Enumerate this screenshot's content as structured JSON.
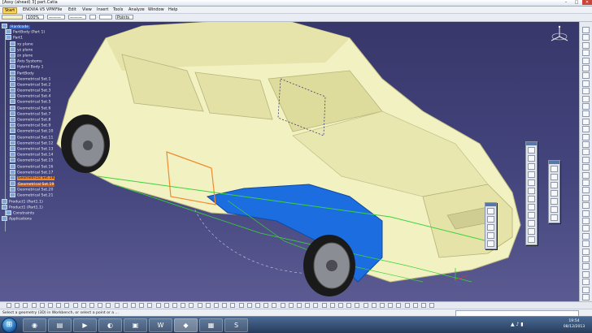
{
  "app": {
    "title": "[Assy (ahead) 3] part.Catia",
    "window_controls": [
      "–",
      "□",
      "✕"
    ]
  },
  "menubar": {
    "start_label": "Start",
    "items": [
      "ENOVIA V5 VPM",
      "File",
      "Edit",
      "View",
      "Insert",
      "Tools",
      "Analyze",
      "Window",
      "Help"
    ]
  },
  "propbar": {
    "color_value": "",
    "opacity_value": "100%",
    "line_type_value": "———",
    "line_weight_value": "———",
    "layer_value": "Points"
  },
  "tree": {
    "nodes": [
      {
        "label": "Hardcode",
        "level": 0,
        "style": "root"
      },
      {
        "label": "PartBody (Part 1)",
        "level": 1,
        "style": ""
      },
      {
        "label": "Part1",
        "level": 1,
        "style": ""
      },
      {
        "label": "xy plane",
        "level": 2,
        "style": ""
      },
      {
        "label": "yz plane",
        "level": 2,
        "style": ""
      },
      {
        "label": "zx plane",
        "level": 2,
        "style": ""
      },
      {
        "label": "Axis Systems",
        "level": 2,
        "style": ""
      },
      {
        "label": "Hybrid Body 1",
        "level": 2,
        "style": ""
      },
      {
        "label": "PartBody",
        "level": 2,
        "style": ""
      },
      {
        "label": "Geometrical Set.1",
        "level": 2,
        "style": ""
      },
      {
        "label": "Geometrical Set.2",
        "level": 2,
        "style": ""
      },
      {
        "label": "Geometrical Set.3",
        "level": 2,
        "style": ""
      },
      {
        "label": "Geometrical Set.4",
        "level": 2,
        "style": ""
      },
      {
        "label": "Geometrical Set.5",
        "level": 2,
        "style": ""
      },
      {
        "label": "Geometrical Set.6",
        "level": 2,
        "style": ""
      },
      {
        "label": "Geometrical Set.7",
        "level": 2,
        "style": ""
      },
      {
        "label": "Geometrical Set.8",
        "level": 2,
        "style": ""
      },
      {
        "label": "Geometrical Set.9",
        "level": 2,
        "style": ""
      },
      {
        "label": "Geometrical Set.10",
        "level": 2,
        "style": ""
      },
      {
        "label": "Geometrical Set.11",
        "level": 2,
        "style": ""
      },
      {
        "label": "Geometrical Set.12",
        "level": 2,
        "style": ""
      },
      {
        "label": "Geometrical Set.13",
        "level": 2,
        "style": ""
      },
      {
        "label": "Geometrical Set.14",
        "level": 2,
        "style": ""
      },
      {
        "label": "Geometrical Set.15",
        "level": 2,
        "style": ""
      },
      {
        "label": "Geometrical Set.16",
        "level": 2,
        "style": ""
      },
      {
        "label": "Geometrical Set.17",
        "level": 2,
        "style": ""
      },
      {
        "label": "Geometrical Set.18",
        "level": 2,
        "style": "hl"
      },
      {
        "label": "Geometrical Set.19",
        "level": 2,
        "style": "sel"
      },
      {
        "label": "Geometrical Set.20",
        "level": 2,
        "style": ""
      },
      {
        "label": "Geometrical Set.21",
        "level": 2,
        "style": ""
      },
      {
        "label": "Product1 (Part1.1)",
        "level": 0,
        "style": ""
      },
      {
        "label": "Product1 (Part1.1)",
        "level": 0,
        "style": ""
      },
      {
        "label": "Constraints",
        "level": 1,
        "style": ""
      },
      {
        "label": "Applications",
        "level": 0,
        "style": ""
      }
    ]
  },
  "status": {
    "message": "Select a geometry (3D) in Workbench, or select a point or a ...",
    "command_value": ""
  },
  "clock": {
    "time": "19:54",
    "date": "08/12/2013"
  },
  "taskbar": {
    "start_glyph": "⊞",
    "apps": [
      {
        "name": "browser",
        "glyph": "◉"
      },
      {
        "name": "explorer",
        "glyph": "▤"
      },
      {
        "name": "media",
        "glyph": "▶"
      },
      {
        "name": "firefox",
        "glyph": "◐"
      },
      {
        "name": "folder",
        "glyph": "▣"
      },
      {
        "name": "word",
        "glyph": "W"
      },
      {
        "name": "catia",
        "glyph": "◆"
      },
      {
        "name": "app8",
        "glyph": "▦"
      },
      {
        "name": "skype",
        "glyph": "S"
      }
    ],
    "tray_glyphs": "▲ ♪ ▮"
  },
  "colors": {
    "viewport_top": "#37376b",
    "car_body": "#f2f1c2",
    "car_shade": "#d7d49a",
    "fender_blue": "#1c6de0",
    "highlight_orange": "#f08a2c",
    "curve_green": "#3ad43a"
  },
  "icons": {
    "compass": "compass-icon",
    "toolbar_right": "tool-icons"
  }
}
